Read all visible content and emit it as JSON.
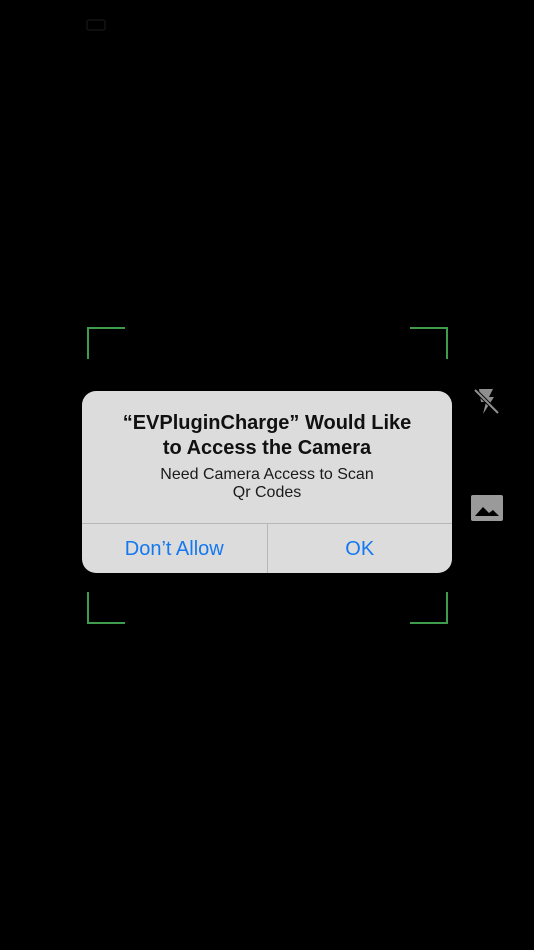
{
  "alert": {
    "title": "“EVPluginCharge” Would Like\nto Access the Camera",
    "message": "Need Camera Access to Scan\nQr Codes",
    "deny_label": "Don’t Allow",
    "allow_label": "OK"
  },
  "controls": {
    "flash_icon": "flash-off-icon",
    "gallery_icon": "photo-library-icon"
  },
  "colors": {
    "background": "#000000",
    "scan_frame": "#3f9c4c",
    "alert_background": "#dcdcdc",
    "action_text": "#1478f0"
  }
}
